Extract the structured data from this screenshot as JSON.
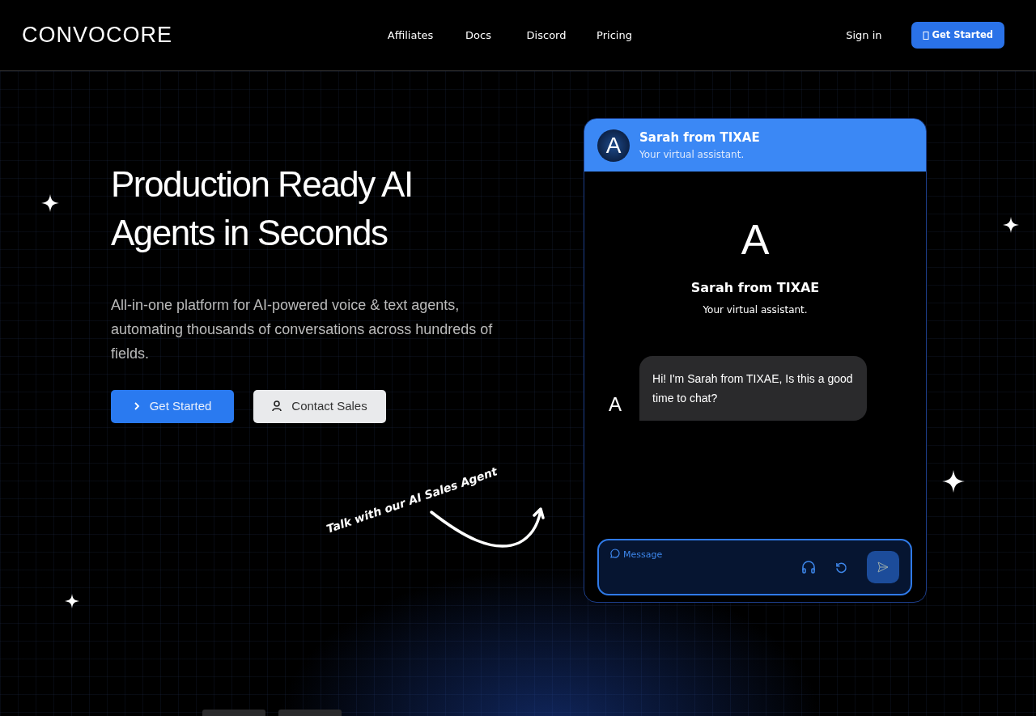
{
  "nav": {
    "logo": "CONVOCORE",
    "links": [
      "Affiliates",
      "Docs",
      "Discord",
      "Pricing"
    ],
    "sign_in": "Sign in",
    "cta": "Get Started"
  },
  "hero": {
    "title": "Production Ready AI Agents in Seconds",
    "subtitle": "All-in-one platform for AI-powered voice & text agents, automating thousands of conversations across hundreds of fields.",
    "buttons": [
      {
        "label": "Get Started",
        "kind": "primary"
      },
      {
        "label": "Contact Sales",
        "kind": "secondary"
      }
    ],
    "note": "Talk with our AI Sales Agent"
  },
  "chat": {
    "name": "Sarah from TIXAE",
    "tagline": "Your virtual assistant.",
    "avatar_letter": "A",
    "intro_letter": "A",
    "intro_name": "Sarah from TIXAE",
    "intro_tagline": "Your virtual assistant.",
    "messages": [
      {
        "avatar_letter": "A",
        "text": "Hi! I'm Sarah from TIXAE, Is this a good time to chat?"
      }
    ],
    "input": {
      "placeholder": "Message"
    }
  }
}
